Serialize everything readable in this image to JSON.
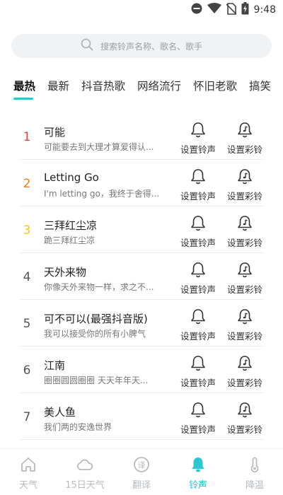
{
  "status_bar": {
    "time": "9:48",
    "icons": [
      "do-not-disturb-icon",
      "wifi-icon",
      "no-sim-icon",
      "battery-charging-icon"
    ]
  },
  "search": {
    "placeholder": "搜索铃声名称、歌名、歌手"
  },
  "tabs": [
    {
      "label": "最热",
      "active": true
    },
    {
      "label": "最新",
      "active": false
    },
    {
      "label": "抖音热歌",
      "active": false
    },
    {
      "label": "网络流行",
      "active": false
    },
    {
      "label": "怀旧老歌",
      "active": false
    },
    {
      "label": "搞笑",
      "active": false
    }
  ],
  "actions": {
    "set_ringtone": "设置铃声",
    "set_crbt": "设置彩铃"
  },
  "rank_colors": {
    "first": "#e8453c",
    "second": "#f07d1e",
    "third": "#f5c525",
    "default": "#555555"
  },
  "songs": [
    {
      "rank": "1",
      "title": "可能",
      "desc": "可能要去到大理才算爱得认..."
    },
    {
      "rank": "2",
      "title": "Letting Go",
      "desc": "I'm letting go，我终于舍得..."
    },
    {
      "rank": "3",
      "title": "三拜红尘凉",
      "desc": "跪三拜红尘凉"
    },
    {
      "rank": "4",
      "title": "天外来物",
      "desc": "你像天外来物一样，求之不..."
    },
    {
      "rank": "5",
      "title": "可不可以(最强抖音版)",
      "desc": "我可以接受你的所有小脾气"
    },
    {
      "rank": "6",
      "title": "江南",
      "desc": "圈圈圆圆圈圈 天天年年天..."
    },
    {
      "rank": "7",
      "title": "美人鱼",
      "desc": "我们两的安逸世界"
    }
  ],
  "bottom_nav": [
    {
      "label": "天气",
      "icon": "house-icon",
      "active": false
    },
    {
      "label": "15日天气",
      "icon": "cloud-icon",
      "active": false
    },
    {
      "label": "翻译",
      "icon": "translate-icon",
      "active": false
    },
    {
      "label": "铃声",
      "icon": "bell-icon",
      "active": true
    },
    {
      "label": "降温",
      "icon": "thermometer-icon",
      "active": false
    }
  ],
  "colors": {
    "accent": "#2ec7d1",
    "inactive_nav": "#b8bcc0"
  }
}
